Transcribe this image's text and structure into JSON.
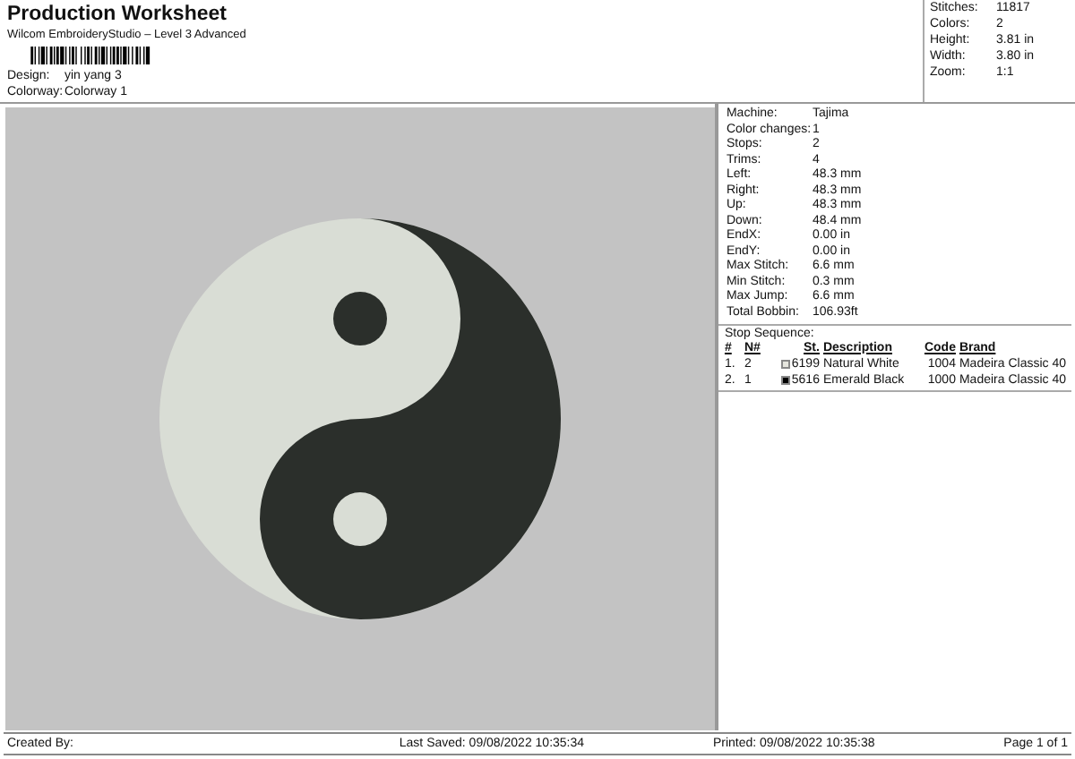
{
  "header": {
    "title": "Production Worksheet",
    "subtitle": "Wilcom EmbroideryStudio – Level 3 Advanced",
    "fields": [
      {
        "label": "Design:",
        "value": "yin  yang 3"
      },
      {
        "label": "Colorway:",
        "value": "Colorway 1"
      }
    ]
  },
  "summary": [
    {
      "label": "Stitches:",
      "value": "11817"
    },
    {
      "label": "Colors:",
      "value": "2"
    },
    {
      "label": "Height:",
      "value": "3.81 in"
    },
    {
      "label": "Width:",
      "value": "3.80 in"
    },
    {
      "label": "Zoom:",
      "value": "1:1"
    }
  ],
  "details": [
    {
      "label": "Machine:",
      "value": "Tajima"
    },
    {
      "label": "Color changes:",
      "value": "1"
    },
    {
      "label": "Stops:",
      "value": "2"
    },
    {
      "label": "Trims:",
      "value": "4"
    },
    {
      "label": "Left:",
      "value": "48.3 mm"
    },
    {
      "label": "Right:",
      "value": "48.3 mm"
    },
    {
      "label": "Up:",
      "value": "48.3 mm"
    },
    {
      "label": "Down:",
      "value": "48.4 mm"
    },
    {
      "label": "EndX:",
      "value": "0.00 in"
    },
    {
      "label": "EndY:",
      "value": "0.00 in"
    },
    {
      "label": "Max Stitch:",
      "value": "6.6 mm"
    },
    {
      "label": "Min Stitch:",
      "value": "0.3 mm"
    },
    {
      "label": "Max Jump:",
      "value": "6.6 mm"
    },
    {
      "label": "Total Bobbin:",
      "value": "106.93ft"
    }
  ],
  "stop_sequence": {
    "title": "Stop Sequence:",
    "columns": [
      "#",
      "N#",
      "St.",
      "Description",
      "Code",
      "Brand"
    ],
    "rows": [
      {
        "index": "1.",
        "needle": "2",
        "color": "#e6e6de",
        "stitches": "6199",
        "description": "Natural White",
        "code": "1004",
        "brand": "Madeira Classic 40"
      },
      {
        "index": "2.",
        "needle": "1",
        "color": "#000000",
        "stitches": "5616",
        "description": "Emerald Black",
        "code": "1000",
        "brand": "Madeira Classic 40"
      }
    ]
  },
  "footer": {
    "created_by": "Created By:",
    "last_saved": "Last Saved: 09/08/2022 10:35:34",
    "printed": "Printed: 09/08/2022 10:35:38",
    "page": "Page 1 of 1"
  }
}
